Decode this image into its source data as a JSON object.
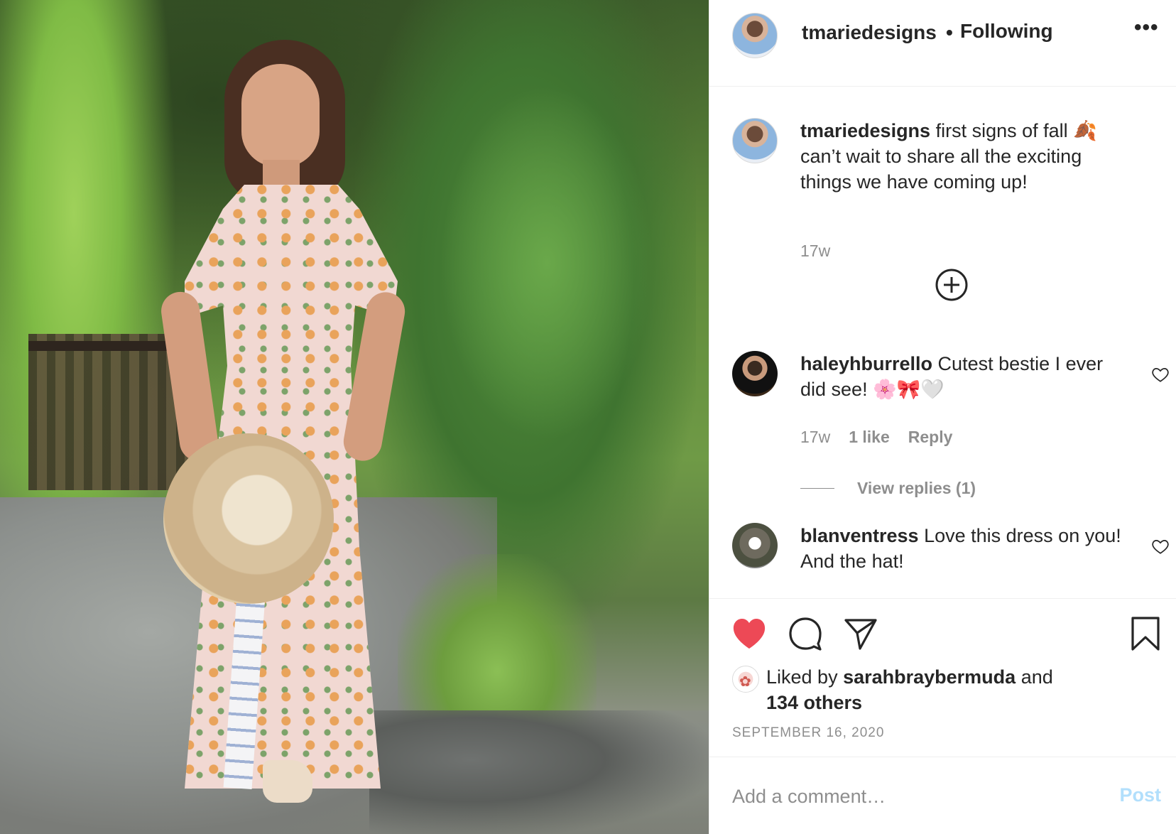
{
  "header": {
    "username": "tmariedesigns",
    "separator": "•",
    "follow_status": "Following",
    "more_label": "•••"
  },
  "caption": {
    "username": "tmariedesigns",
    "text": " first signs of fall 🍂 can’t wait to share all the exciting things we have coming up!",
    "timestamp": "17w"
  },
  "comments": [
    {
      "username": "haleyhburrello",
      "text": " Cutest bestie I ever did see! 🌸🎀🤍",
      "timestamp": "17w",
      "likes": "1 like",
      "reply_label": "Reply",
      "view_replies": "View replies (1)"
    },
    {
      "username": "blanventress",
      "text": " Love this dress on you! And the hat!"
    }
  ],
  "liked_by": {
    "prefix": "Liked by ",
    "user": "sarahbraybermuda",
    "middle": " and",
    "others": "134 others"
  },
  "date": "SEPTEMBER 16, 2020",
  "add_comment": {
    "placeholder": "Add a comment…",
    "post_label": "Post"
  },
  "icons": {
    "like": "heart-filled-icon",
    "comment": "speech-bubble-icon",
    "share": "paper-plane-icon",
    "save": "bookmark-icon",
    "more": "ellipsis-icon",
    "load_more": "plus-circle-icon",
    "comment_like": "heart-outline-icon"
  },
  "colors": {
    "like_red": "#ed4956",
    "secondary_text": "#8e8e8e",
    "post_button_disabled": "#b2dffc"
  }
}
